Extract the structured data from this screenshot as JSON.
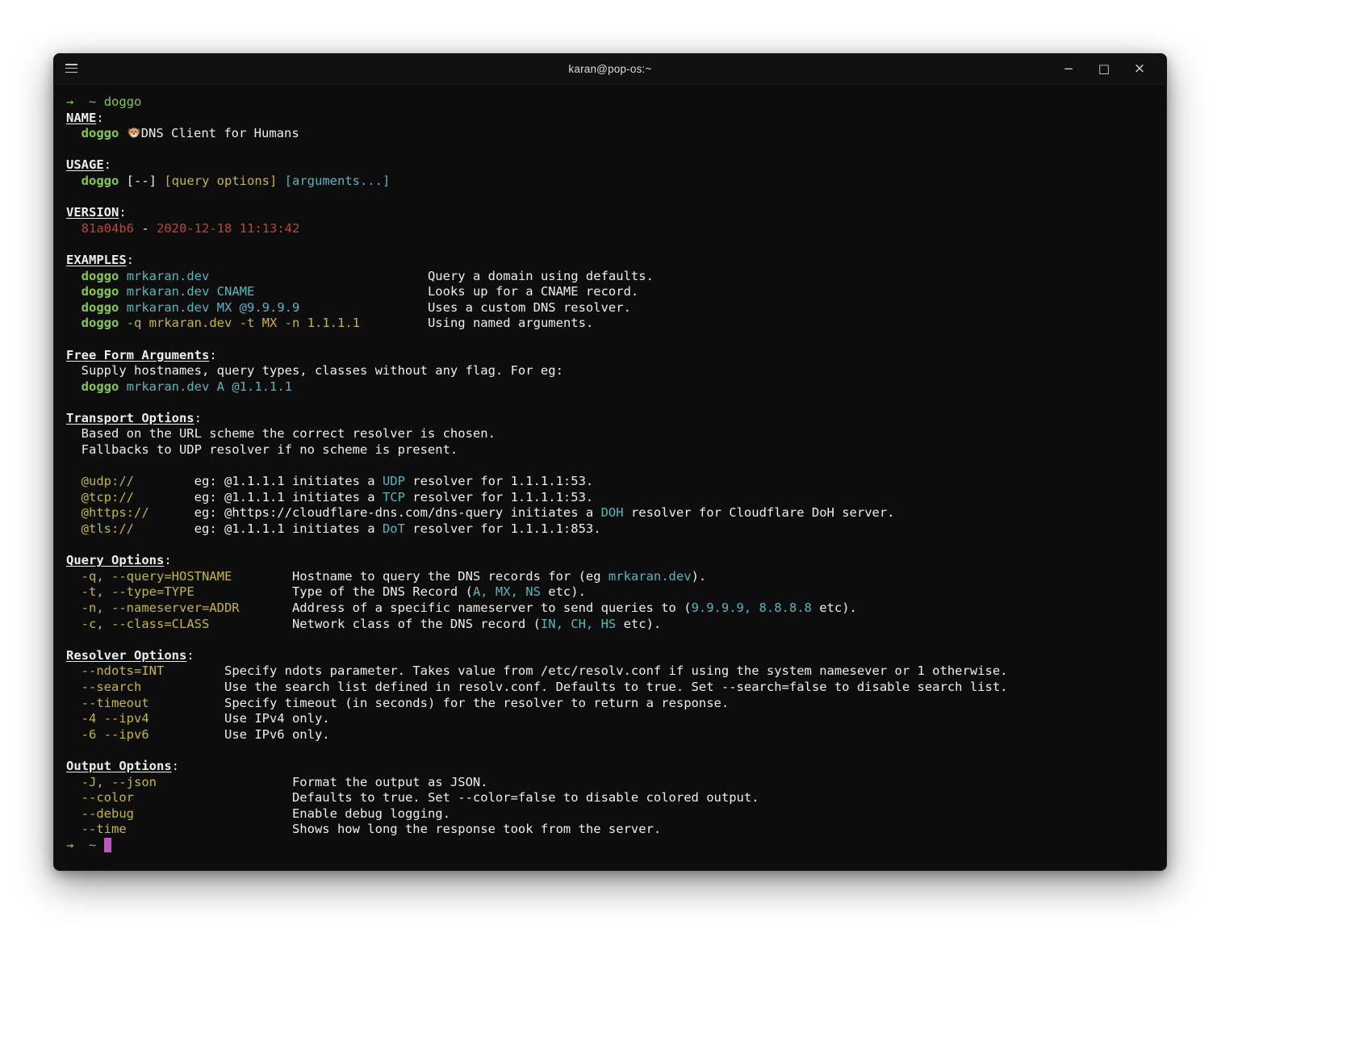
{
  "window": {
    "title": "karan@pop-os:~",
    "icons": {
      "menu": "hamburger-lines",
      "minimize": "−",
      "maximize": "□",
      "close": "×"
    }
  },
  "palette": {
    "background": "#0d0d0d",
    "foreground": "#eeeeec",
    "green": "#87c851",
    "cyan": "#56b6be",
    "yellow": "#c2b63f",
    "red": "#bb4632",
    "magenta": "#c452c8"
  },
  "terminal": {
    "prompt_symbol": "→",
    "dog_emoji": "🐶",
    "lines": [
      {
        "segments": [
          [
            "green",
            "→"
          ],
          [
            "fg",
            "  "
          ],
          [
            "cyan",
            "~"
          ],
          [
            "fg",
            " "
          ],
          [
            "green",
            "doggo"
          ]
        ]
      },
      {
        "segments": [
          [
            "header",
            "NAME"
          ],
          [
            "fg",
            ":"
          ]
        ]
      },
      {
        "segments": [
          [
            "fg",
            "  "
          ],
          [
            "bgreen",
            "doggo"
          ],
          [
            "fg",
            " "
          ],
          [
            "emoji",
            "🐶"
          ],
          [
            "fg",
            "DNS Client for Humans"
          ]
        ]
      },
      {
        "segments": []
      },
      {
        "segments": [
          [
            "header",
            "USAGE"
          ],
          [
            "fg",
            ":"
          ]
        ]
      },
      {
        "segments": [
          [
            "fg",
            "  "
          ],
          [
            "bgreen",
            "doggo"
          ],
          [
            "fg",
            " [--] "
          ],
          [
            "yellow",
            "[query options]"
          ],
          [
            "fg",
            " "
          ],
          [
            "cyan",
            "[arguments...]"
          ]
        ]
      },
      {
        "segments": []
      },
      {
        "segments": [
          [
            "header",
            "VERSION"
          ],
          [
            "fg",
            ":"
          ]
        ]
      },
      {
        "segments": [
          [
            "fg",
            "  "
          ],
          [
            "red",
            "81a04b6"
          ],
          [
            "fg",
            " - "
          ],
          [
            "red",
            "2020-12-18 11:13:42"
          ]
        ]
      },
      {
        "segments": []
      },
      {
        "segments": [
          [
            "header",
            "EXAMPLES"
          ],
          [
            "fg",
            ":"
          ]
        ]
      },
      {
        "segments": [
          [
            "fg",
            "  "
          ],
          [
            "bgreen",
            "doggo"
          ],
          [
            "fg",
            " "
          ],
          [
            "cyan",
            "mrkaran.dev"
          ],
          [
            "fg",
            "                             Query a domain using defaults."
          ]
        ]
      },
      {
        "segments": [
          [
            "fg",
            "  "
          ],
          [
            "bgreen",
            "doggo"
          ],
          [
            "fg",
            " "
          ],
          [
            "cyan",
            "mrkaran.dev CNAME"
          ],
          [
            "fg",
            "                       Looks up for a CNAME record."
          ]
        ]
      },
      {
        "segments": [
          [
            "fg",
            "  "
          ],
          [
            "bgreen",
            "doggo"
          ],
          [
            "fg",
            " "
          ],
          [
            "cyan",
            "mrkaran.dev MX @9.9.9.9"
          ],
          [
            "fg",
            "                 Uses a custom DNS resolver."
          ]
        ]
      },
      {
        "segments": [
          [
            "fg",
            "  "
          ],
          [
            "bgreen",
            "doggo"
          ],
          [
            "fg",
            " "
          ],
          [
            "yellow",
            "-q mrkaran.dev -t MX -n 1.1.1.1"
          ],
          [
            "fg",
            "         Using named arguments."
          ]
        ]
      },
      {
        "segments": []
      },
      {
        "segments": [
          [
            "header",
            "Free Form Arguments"
          ],
          [
            "fg",
            ":"
          ]
        ]
      },
      {
        "segments": [
          [
            "fg",
            "  Supply hostnames, query types, classes without any flag. For eg:"
          ]
        ]
      },
      {
        "segments": [
          [
            "fg",
            "  "
          ],
          [
            "bgreen",
            "doggo"
          ],
          [
            "fg",
            " "
          ],
          [
            "cyan",
            "mrkaran.dev A @1.1.1.1"
          ]
        ]
      },
      {
        "segments": []
      },
      {
        "segments": [
          [
            "header",
            "Transport Options"
          ],
          [
            "fg",
            ":"
          ]
        ]
      },
      {
        "segments": [
          [
            "fg",
            "  Based on the URL scheme the correct resolver is chosen."
          ]
        ]
      },
      {
        "segments": [
          [
            "fg",
            "  Fallbacks to UDP resolver if no scheme is present."
          ]
        ]
      },
      {
        "segments": []
      },
      {
        "segments": [
          [
            "fg",
            "  "
          ],
          [
            "yellow",
            "@udp://"
          ],
          [
            "fg",
            "        eg: @1.1.1.1 initiates a "
          ],
          [
            "cyan",
            "UDP"
          ],
          [
            "fg",
            " resolver for 1.1.1.1:53."
          ]
        ]
      },
      {
        "segments": [
          [
            "fg",
            "  "
          ],
          [
            "yellow",
            "@tcp://"
          ],
          [
            "fg",
            "        eg: @1.1.1.1 initiates a "
          ],
          [
            "cyan",
            "TCP"
          ],
          [
            "fg",
            " resolver for 1.1.1.1:53."
          ]
        ]
      },
      {
        "segments": [
          [
            "fg",
            "  "
          ],
          [
            "yellow",
            "@https://"
          ],
          [
            "fg",
            "      eg: @https://cloudflare-dns.com/dns-query initiates a "
          ],
          [
            "cyan",
            "DOH"
          ],
          [
            "fg",
            " resolver for Cloudflare DoH server."
          ]
        ]
      },
      {
        "segments": [
          [
            "fg",
            "  "
          ],
          [
            "yellow",
            "@tls://"
          ],
          [
            "fg",
            "        eg: @1.1.1.1 initiates a "
          ],
          [
            "cyan",
            "DoT"
          ],
          [
            "fg",
            " resolver for 1.1.1.1:853."
          ]
        ]
      },
      {
        "segments": []
      },
      {
        "segments": [
          [
            "header",
            "Query Options"
          ],
          [
            "fg",
            ":"
          ]
        ]
      },
      {
        "segments": [
          [
            "fg",
            "  "
          ],
          [
            "yellow",
            "-q, --query=HOSTNAME"
          ],
          [
            "fg",
            "        Hostname to query the DNS records for (eg "
          ],
          [
            "cyan",
            "mrkaran.dev"
          ],
          [
            "fg",
            ")."
          ]
        ]
      },
      {
        "segments": [
          [
            "fg",
            "  "
          ],
          [
            "yellow",
            "-t, --type=TYPE"
          ],
          [
            "fg",
            "             Type of the DNS Record ("
          ],
          [
            "cyan",
            "A, MX, NS"
          ],
          [
            "fg",
            " etc)."
          ]
        ]
      },
      {
        "segments": [
          [
            "fg",
            "  "
          ],
          [
            "yellow",
            "-n, --nameserver=ADDR"
          ],
          [
            "fg",
            "       Address of a specific nameserver to send queries to ("
          ],
          [
            "cyan",
            "9.9.9.9, 8.8.8.8"
          ],
          [
            "fg",
            " etc)."
          ]
        ]
      },
      {
        "segments": [
          [
            "fg",
            "  "
          ],
          [
            "yellow",
            "-c, --class=CLASS"
          ],
          [
            "fg",
            "           Network class of the DNS record ("
          ],
          [
            "cyan",
            "IN, CH, HS"
          ],
          [
            "fg",
            " etc)."
          ]
        ]
      },
      {
        "segments": []
      },
      {
        "segments": [
          [
            "header",
            "Resolver Options"
          ],
          [
            "fg",
            ":"
          ]
        ]
      },
      {
        "segments": [
          [
            "fg",
            "  "
          ],
          [
            "yellow",
            "--ndots=INT"
          ],
          [
            "fg",
            "        Specify ndots parameter. Takes value from /etc/resolv.conf if using the system namesever or 1 otherwise."
          ]
        ]
      },
      {
        "segments": [
          [
            "fg",
            "  "
          ],
          [
            "yellow",
            "--search"
          ],
          [
            "fg",
            "           Use the search list defined in resolv.conf. Defaults to true. Set --search=false to disable search list."
          ]
        ]
      },
      {
        "segments": [
          [
            "fg",
            "  "
          ],
          [
            "yellow",
            "--timeout"
          ],
          [
            "fg",
            "          Specify timeout (in seconds) for the resolver to return a response."
          ]
        ]
      },
      {
        "segments": [
          [
            "fg",
            "  "
          ],
          [
            "yellow",
            "-4 --ipv4"
          ],
          [
            "fg",
            "          Use IPv4 only."
          ]
        ]
      },
      {
        "segments": [
          [
            "fg",
            "  "
          ],
          [
            "yellow",
            "-6 --ipv6"
          ],
          [
            "fg",
            "          Use IPv6 only."
          ]
        ]
      },
      {
        "segments": []
      },
      {
        "segments": [
          [
            "header",
            "Output Options"
          ],
          [
            "fg",
            ":"
          ]
        ]
      },
      {
        "segments": [
          [
            "fg",
            "  "
          ],
          [
            "yellow",
            "-J, --json"
          ],
          [
            "fg",
            "                  Format the output as JSON."
          ]
        ]
      },
      {
        "segments": [
          [
            "fg",
            "  "
          ],
          [
            "yellow",
            "--color"
          ],
          [
            "fg",
            "                     Defaults to true. Set --color=false to disable colored output."
          ]
        ]
      },
      {
        "segments": [
          [
            "fg",
            "  "
          ],
          [
            "yellow",
            "--debug"
          ],
          [
            "fg",
            "                     Enable debug logging."
          ]
        ]
      },
      {
        "segments": [
          [
            "fg",
            "  "
          ],
          [
            "yellow",
            "--time"
          ],
          [
            "fg",
            "                      Shows how long the response took from the server."
          ]
        ]
      },
      {
        "segments": [
          [
            "green",
            "→"
          ],
          [
            "fg",
            "  "
          ],
          [
            "cyan",
            "~"
          ],
          [
            "fg",
            " "
          ],
          [
            "cursor",
            " "
          ]
        ]
      }
    ]
  }
}
